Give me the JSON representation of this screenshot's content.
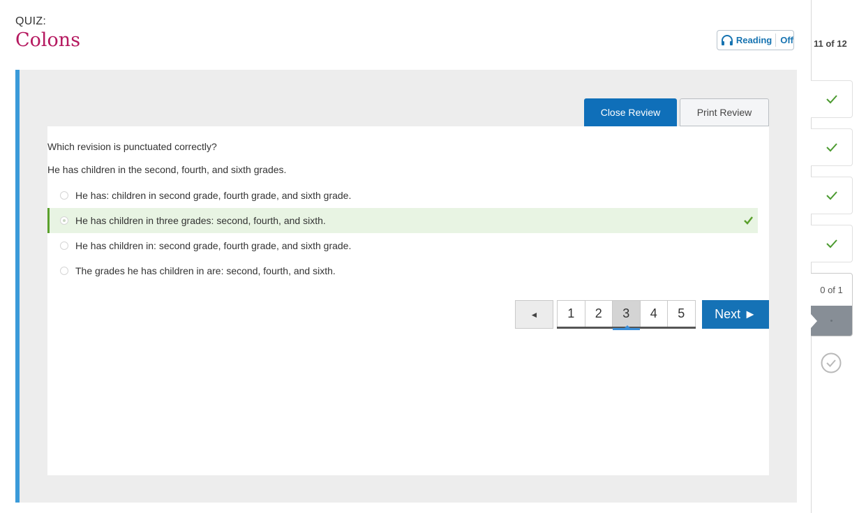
{
  "header": {
    "quiz_label": "QUIZ:",
    "title": "Colons"
  },
  "reading_toggle": {
    "label": "Reading",
    "state": "Off",
    "icon": "headphones-icon"
  },
  "review": {
    "close_label": "Close Review",
    "print_label": "Print Review"
  },
  "question": {
    "prompt": "Which revision is punctuated correctly?",
    "sentence": "He has children in the second, fourth, and sixth grades.",
    "choices": [
      {
        "text": "He has: children in second grade, fourth grade, and sixth grade.",
        "correct": false
      },
      {
        "text": "He has children in three grades: second, fourth, and sixth.",
        "correct": true
      },
      {
        "text": "He has children in: second grade, fourth grade, and sixth grade.",
        "correct": false
      },
      {
        "text": "The grades he has children in are: second, fourth, and sixth.",
        "correct": false
      }
    ]
  },
  "pagination": {
    "prev_symbol": "◄",
    "pages": [
      "1",
      "2",
      "3",
      "4",
      "5"
    ],
    "current_page": "3",
    "next_label": "Next ►"
  },
  "sidebar": {
    "progress": "11 of 12",
    "completed_items": 4,
    "current_count": "0 of 1"
  },
  "colors": {
    "title": "#b5185f",
    "accent": "#0f6fb9",
    "correct": "#5aa02c",
    "panel_border": "#3a9ad9"
  }
}
